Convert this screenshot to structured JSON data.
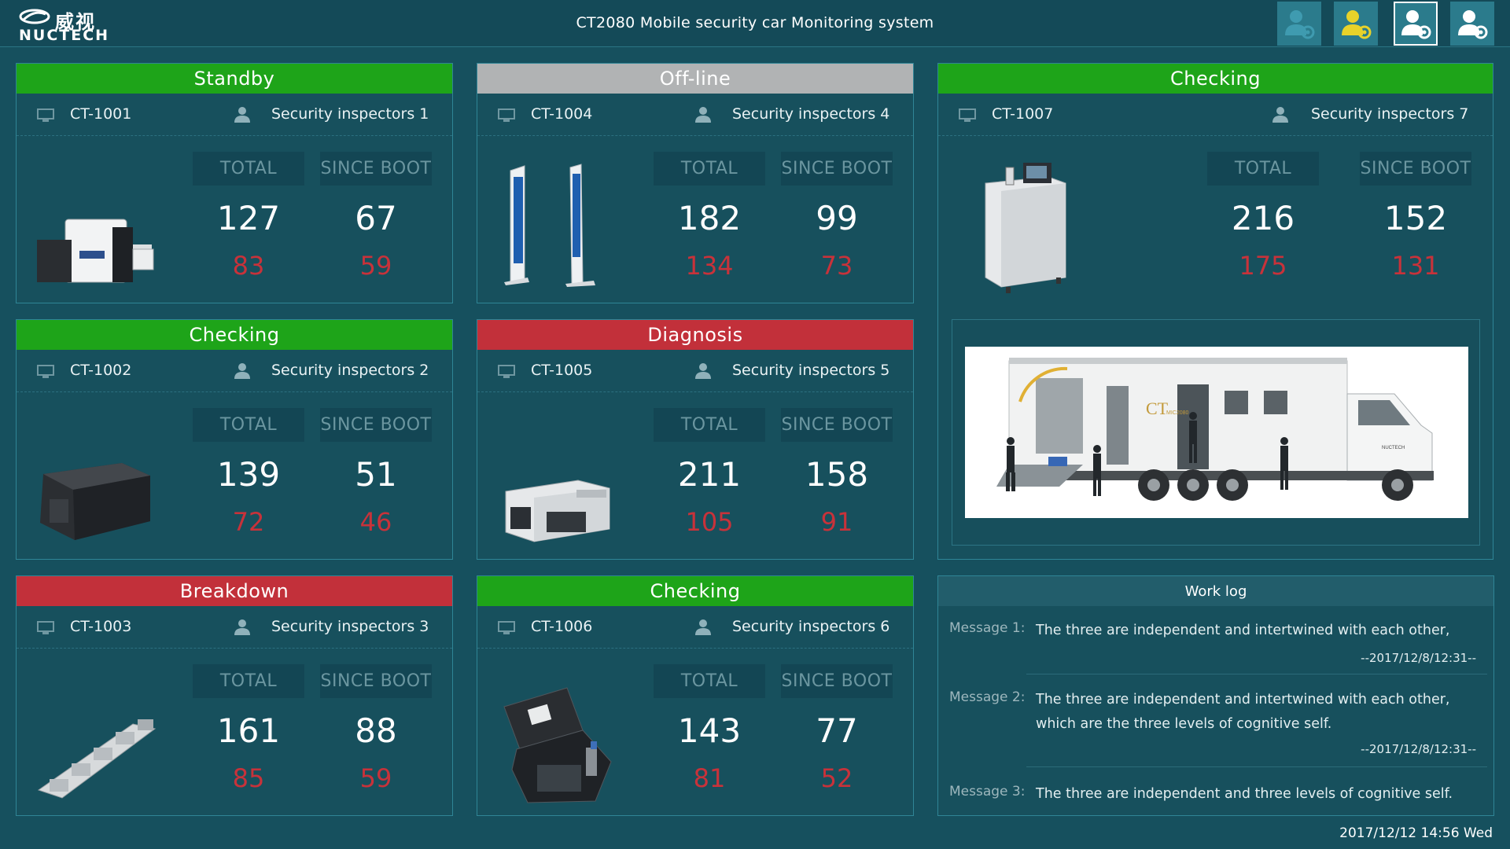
{
  "header": {
    "logo_cn": "威视",
    "logo_en": "NUCTECH",
    "title": "CT2080 Mobile security car  Monitoring system",
    "user_buttons": [
      {
        "icon": "user-settings-icon",
        "color": "#3a8ea0"
      },
      {
        "icon": "user-settings-icon",
        "color": "#e8d22a"
      },
      {
        "icon": "user-settings-icon",
        "color": "#3a8ea0"
      },
      {
        "icon": "user-settings-icon",
        "color": "#3a8ea0"
      }
    ]
  },
  "labels": {
    "total": "TOTAL",
    "since_boot": "SINCE BOOT"
  },
  "devices": [
    {
      "status": "Standby",
      "status_color": "green",
      "id": "CT-1001",
      "inspector": "Security inspectors 1",
      "total": "127",
      "since_boot": "67",
      "total_red": "83",
      "since_boot_red": "59",
      "image": "ct-scanner-machine"
    },
    {
      "status": "Off-line",
      "status_color": "gray",
      "id": "CT-1004",
      "inspector": "Security inspectors 4",
      "total": "182",
      "since_boot": "99",
      "total_red": "134",
      "since_boot_red": "73",
      "image": "walk-through-gates"
    },
    {
      "status": "Checking",
      "status_color": "green",
      "id": "CT-1007",
      "inspector": "Security inspectors 7",
      "total": "216",
      "since_boot": "152",
      "total_red": "175",
      "since_boot_red": "131",
      "image": "liquid-scanner"
    },
    {
      "status": "Checking",
      "status_color": "green",
      "id": "CT-1002",
      "inspector": "Security inspectors 2",
      "total": "139",
      "since_boot": "51",
      "total_red": "72",
      "since_boot_red": "46",
      "image": "desktop-scanner"
    },
    {
      "status": "Diagnosis",
      "status_color": "red",
      "id": "CT-1005",
      "inspector": "Security inspectors 5",
      "total": "211",
      "since_boot": "158",
      "total_red": "105",
      "since_boot_red": "91",
      "image": "baggage-scanner"
    },
    {
      "status": "Breakdown",
      "status_color": "red",
      "id": "CT-1003",
      "inspector": "Security inspectors 3",
      "total": "161",
      "since_boot": "88",
      "total_red": "85",
      "since_boot_red": "59",
      "image": "conveyor-line"
    },
    {
      "status": "Checking",
      "status_color": "green",
      "id": "CT-1006",
      "inspector": "Security inspectors 6",
      "total": "143",
      "since_boot": "77",
      "total_red": "81",
      "since_boot_red": "52",
      "image": "portable-case"
    }
  ],
  "truck": {
    "side_logo": "CT",
    "side_logo_sub": "MIC2080",
    "side_brand": "NUCTECH"
  },
  "worklog": {
    "title": "Work log",
    "messages": [
      {
        "label": "Message 1:",
        "text": "The three are independent and intertwined with each other,",
        "time": "--2017/12/8/12:31--"
      },
      {
        "label": "Message 2:",
        "text": "The three are independent and intertwined with each other, which are the three levels of cognitive self.",
        "time": "--2017/12/8/12:31--"
      },
      {
        "label": "Message 3:",
        "text": "The three are independent and  three levels of cognitive self.",
        "time": ""
      }
    ]
  },
  "clock": "2017/12/12 14:56 Wed",
  "colors": {
    "background": "#16505e",
    "green": "#1ea419",
    "gray": "#b1b3b4",
    "red": "#c2303a",
    "alert_number": "#c8323a"
  }
}
